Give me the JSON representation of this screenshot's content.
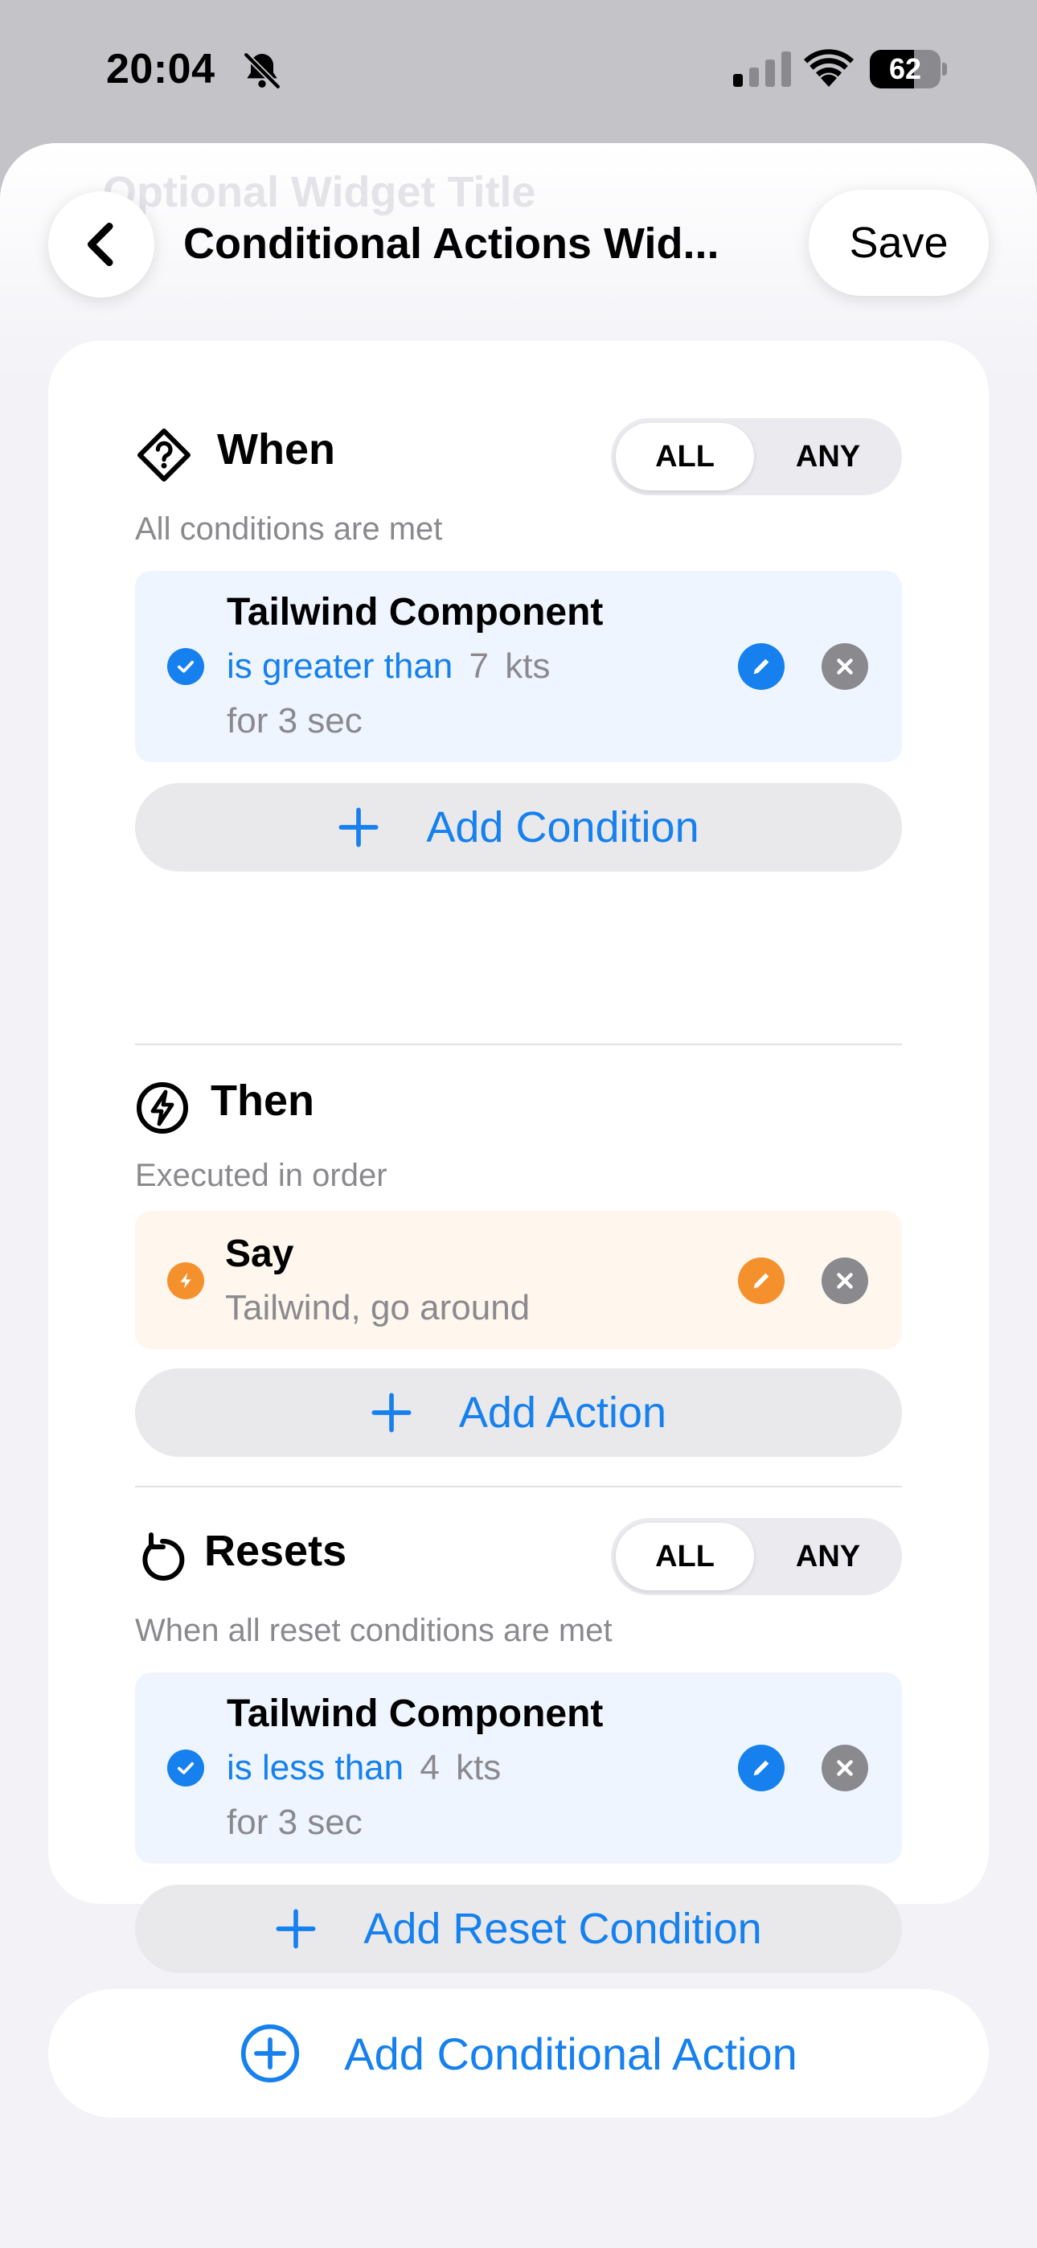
{
  "status_bar": {
    "time": "20:04",
    "battery": "62",
    "battery_level": 0.62,
    "icons": [
      "bell-slash-icon",
      "signal-icon",
      "wifi-icon",
      "battery-icon"
    ]
  },
  "header": {
    "ghost_title": "Optional Widget Title",
    "title": "Conditional Actions Wid...",
    "save_label": "Save",
    "back_icon": "chevron-left-icon"
  },
  "when": {
    "title": "When",
    "icon": "question-diamond-icon",
    "subtitle": "All conditions are met",
    "segment": {
      "all": "ALL",
      "any": "ANY",
      "selected": "ALL"
    },
    "condition": {
      "title": "Tailwind Component",
      "operator": "is greater than",
      "value": "7",
      "unit": "kts",
      "duration": "for 3 sec"
    },
    "add_label": "Add Condition"
  },
  "then": {
    "title": "Then",
    "icon": "bolt-circle-icon",
    "subtitle": "Executed in order",
    "action": {
      "title": "Say",
      "detail": "Tailwind, go around"
    },
    "add_label": "Add Action"
  },
  "resets": {
    "title": "Resets",
    "icon": "arrow-counterclockwise-icon",
    "subtitle": "When all reset conditions are met",
    "segment": {
      "all": "ALL",
      "any": "ANY",
      "selected": "ALL"
    },
    "condition": {
      "title": "Tailwind Component",
      "operator": "is less than",
      "value": "4",
      "unit": "kts",
      "duration": "for 3 sec"
    },
    "add_label": "Add Reset Condition"
  },
  "footer": {
    "add_label": "Add Conditional Action"
  },
  "colors": {
    "accent_blue": "#1580ee",
    "accent_orange": "#f5912d",
    "gray": "#8a8a8e",
    "sheet_bg": "#f2f2f7"
  }
}
